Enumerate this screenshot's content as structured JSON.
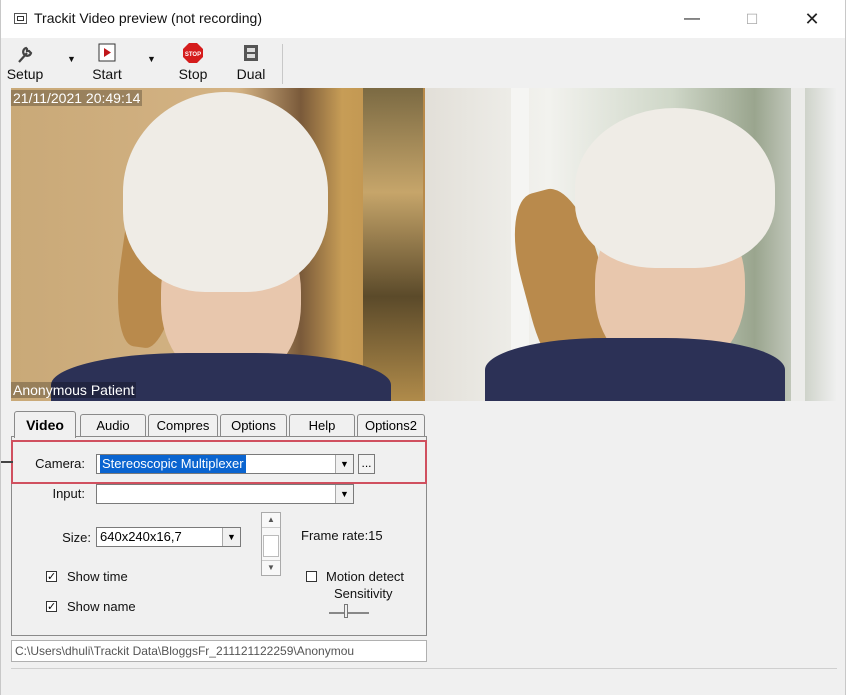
{
  "window": {
    "title": "Trackit Video preview (not recording)",
    "minimize": "—",
    "maximize": "☐",
    "close": "✕"
  },
  "toolbar": {
    "setup_label": "Setup",
    "start_label": "Start",
    "stop_label": "Stop",
    "dual_label": "Dual"
  },
  "video": {
    "timestamp": "21/11/2021 20:49:14",
    "patient_name": "Anonymous Patient"
  },
  "tabs": [
    "Video",
    "Audio",
    "Compres",
    "Options",
    "Help",
    "Options2"
  ],
  "video_tab": {
    "camera_label": "Camera:",
    "camera_value": "Stereoscopic Multiplexer",
    "browse_label": "...",
    "input_label": "Input:",
    "input_value": "",
    "size_label": "Size:",
    "size_value": "640x240x16,7",
    "frame_rate": "Frame rate:15",
    "show_time_label": "Show time",
    "show_time_checked": true,
    "show_name_label": "Show name",
    "show_name_checked": true,
    "motion_detect_label": "Motion detect",
    "motion_detect_checked": false,
    "sensitivity_label": "Sensitivity"
  },
  "path": "C:\\Users\\dhuli\\Trackit Data\\BloggsFr_211121122259\\Anonymou",
  "colors": {
    "highlight_border": "#d0505f",
    "selection": "#0a64d0"
  }
}
